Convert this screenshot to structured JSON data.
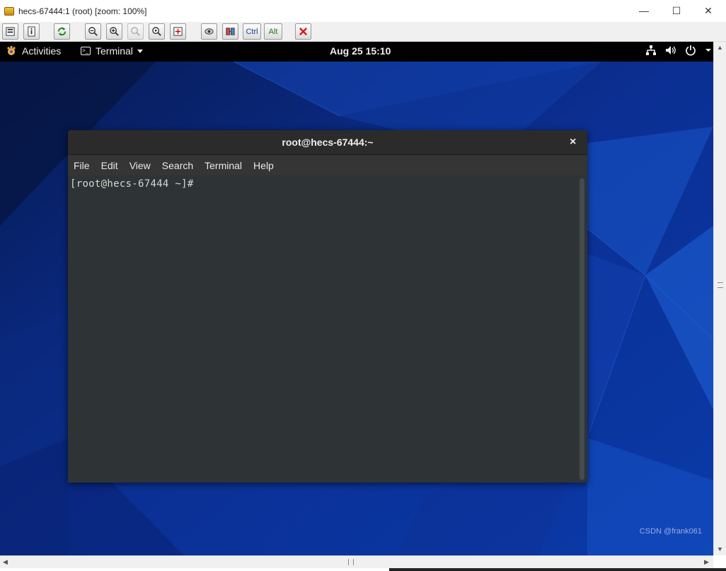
{
  "window": {
    "title": "hecs-67444:1 (root) [zoom: 100%]",
    "controls": {
      "minimize": "—",
      "maximize": "☐",
      "close": "✕"
    }
  },
  "toolbar": {
    "buttons": [
      {
        "name": "options-button",
        "icon": "options-icon"
      },
      {
        "name": "connection-info-button",
        "icon": "info-icon"
      },
      {
        "name": "refresh-button",
        "icon": "refresh-icon"
      },
      {
        "name": "zoom-out-button",
        "icon": "zoom-out-icon"
      },
      {
        "name": "zoom-in-button",
        "icon": "zoom-in-icon"
      },
      {
        "name": "zoom-100-button",
        "icon": "zoom-100-icon"
      },
      {
        "name": "zoom-fit-button",
        "icon": "zoom-fit-icon"
      },
      {
        "name": "fullscreen-button",
        "icon": "fullscreen-icon"
      },
      {
        "name": "ctrl-alt-del-button",
        "icon": "ctrl-alt-del-icon"
      },
      {
        "name": "transfer-files-button",
        "icon": "files-icon"
      },
      {
        "name": "ctrl-button",
        "label": "Ctrl"
      },
      {
        "name": "alt-button",
        "label": "Alt"
      },
      {
        "name": "disconnect-button",
        "icon": "disconnect-icon"
      }
    ],
    "ctrl_label": "Ctrl",
    "alt_label": "Alt"
  },
  "gnome_bar": {
    "activities": "Activities",
    "app_menu": "Terminal",
    "clock": "Aug 25  15:10",
    "tray_icons": [
      "network-icon",
      "volume-icon",
      "power-icon"
    ]
  },
  "terminal": {
    "title": "root@hecs-67444:~",
    "close": "×",
    "menu": [
      "File",
      "Edit",
      "View",
      "Search",
      "Terminal",
      "Help"
    ],
    "prompt": "[root@hecs-67444 ~]#"
  },
  "watermark": "CSDN @frank061",
  "colors": {
    "desktop_blue": "#0a2a86",
    "gnome_bar": "#000000",
    "terminal_bg": "#2e3436",
    "terminal_header": "#2b2b2b"
  }
}
